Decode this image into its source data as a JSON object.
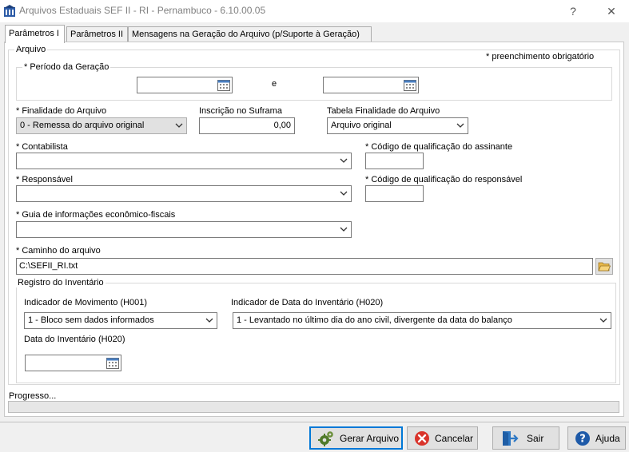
{
  "window": {
    "title": "Arquivos Estaduais SEF II - RI - Pernambuco - 6.10.00.05",
    "help_glyph": "?",
    "close_glyph": "✕"
  },
  "tabs": [
    {
      "label": "Parâmetros I",
      "active": true
    },
    {
      "label": "Parâmetros II",
      "active": false
    },
    {
      "label": "Mensagens na Geração do Arquivo (p/Suporte à Geração)",
      "active": false
    }
  ],
  "arquivo": {
    "group_label": "Arquivo",
    "required_note": "* preenchimento obrigatório",
    "periodo": {
      "label": "* Período da Geração",
      "start_value": "",
      "separator": "e",
      "end_value": ""
    },
    "finalidade": {
      "label": "* Finalidade do Arquivo",
      "value": "0 - Remessa do arquivo original"
    },
    "suframa": {
      "label": "Inscrição no Suframa",
      "value": "0,00"
    },
    "tabela_finalidade": {
      "label": "Tabela Finalidade do Arquivo",
      "value": "Arquivo original"
    },
    "contabilista": {
      "label": "* Contabilista",
      "value": ""
    },
    "cod_assinante": {
      "label": "* Código de qualificação do assinante",
      "value": ""
    },
    "responsavel": {
      "label": "* Responsável",
      "value": ""
    },
    "cod_responsavel": {
      "label": "* Código de qualificação do responsável",
      "value": ""
    },
    "guia": {
      "label": "* Guia de informações econômico-fiscais",
      "value": ""
    },
    "caminho": {
      "label": "* Caminho do arquivo",
      "value": "C:\\SEFII_RI.txt"
    }
  },
  "inventario": {
    "group_label": "Registro do Inventário",
    "movimento": {
      "label": "Indicador de Movimento (H001)",
      "value": "1 - Bloco sem dados informados"
    },
    "data_indicador": {
      "label": "Indicador de Data do Inventário (H020)",
      "value": "1 - Levantado no último dia do ano civil, divergente da data do balanço"
    },
    "data": {
      "label": "Data do Inventário (H020)",
      "value": ""
    }
  },
  "progress": {
    "label": "Progresso...",
    "value": 0
  },
  "buttons": {
    "gerar": {
      "label": "Gerar Arquivo",
      "icon": "gear-icon"
    },
    "cancelar": {
      "label": "Cancelar",
      "icon": "cancel-icon"
    },
    "sair": {
      "label": "Sair",
      "icon": "exit-door-icon"
    },
    "ajuda": {
      "label": "Ajuda",
      "icon": "help-icon"
    }
  },
  "colors": {
    "accent": "#0078d7",
    "cancel_red": "#d9342b",
    "help_blue": "#1e5aa8",
    "exit_blue": "#2f78c4"
  }
}
